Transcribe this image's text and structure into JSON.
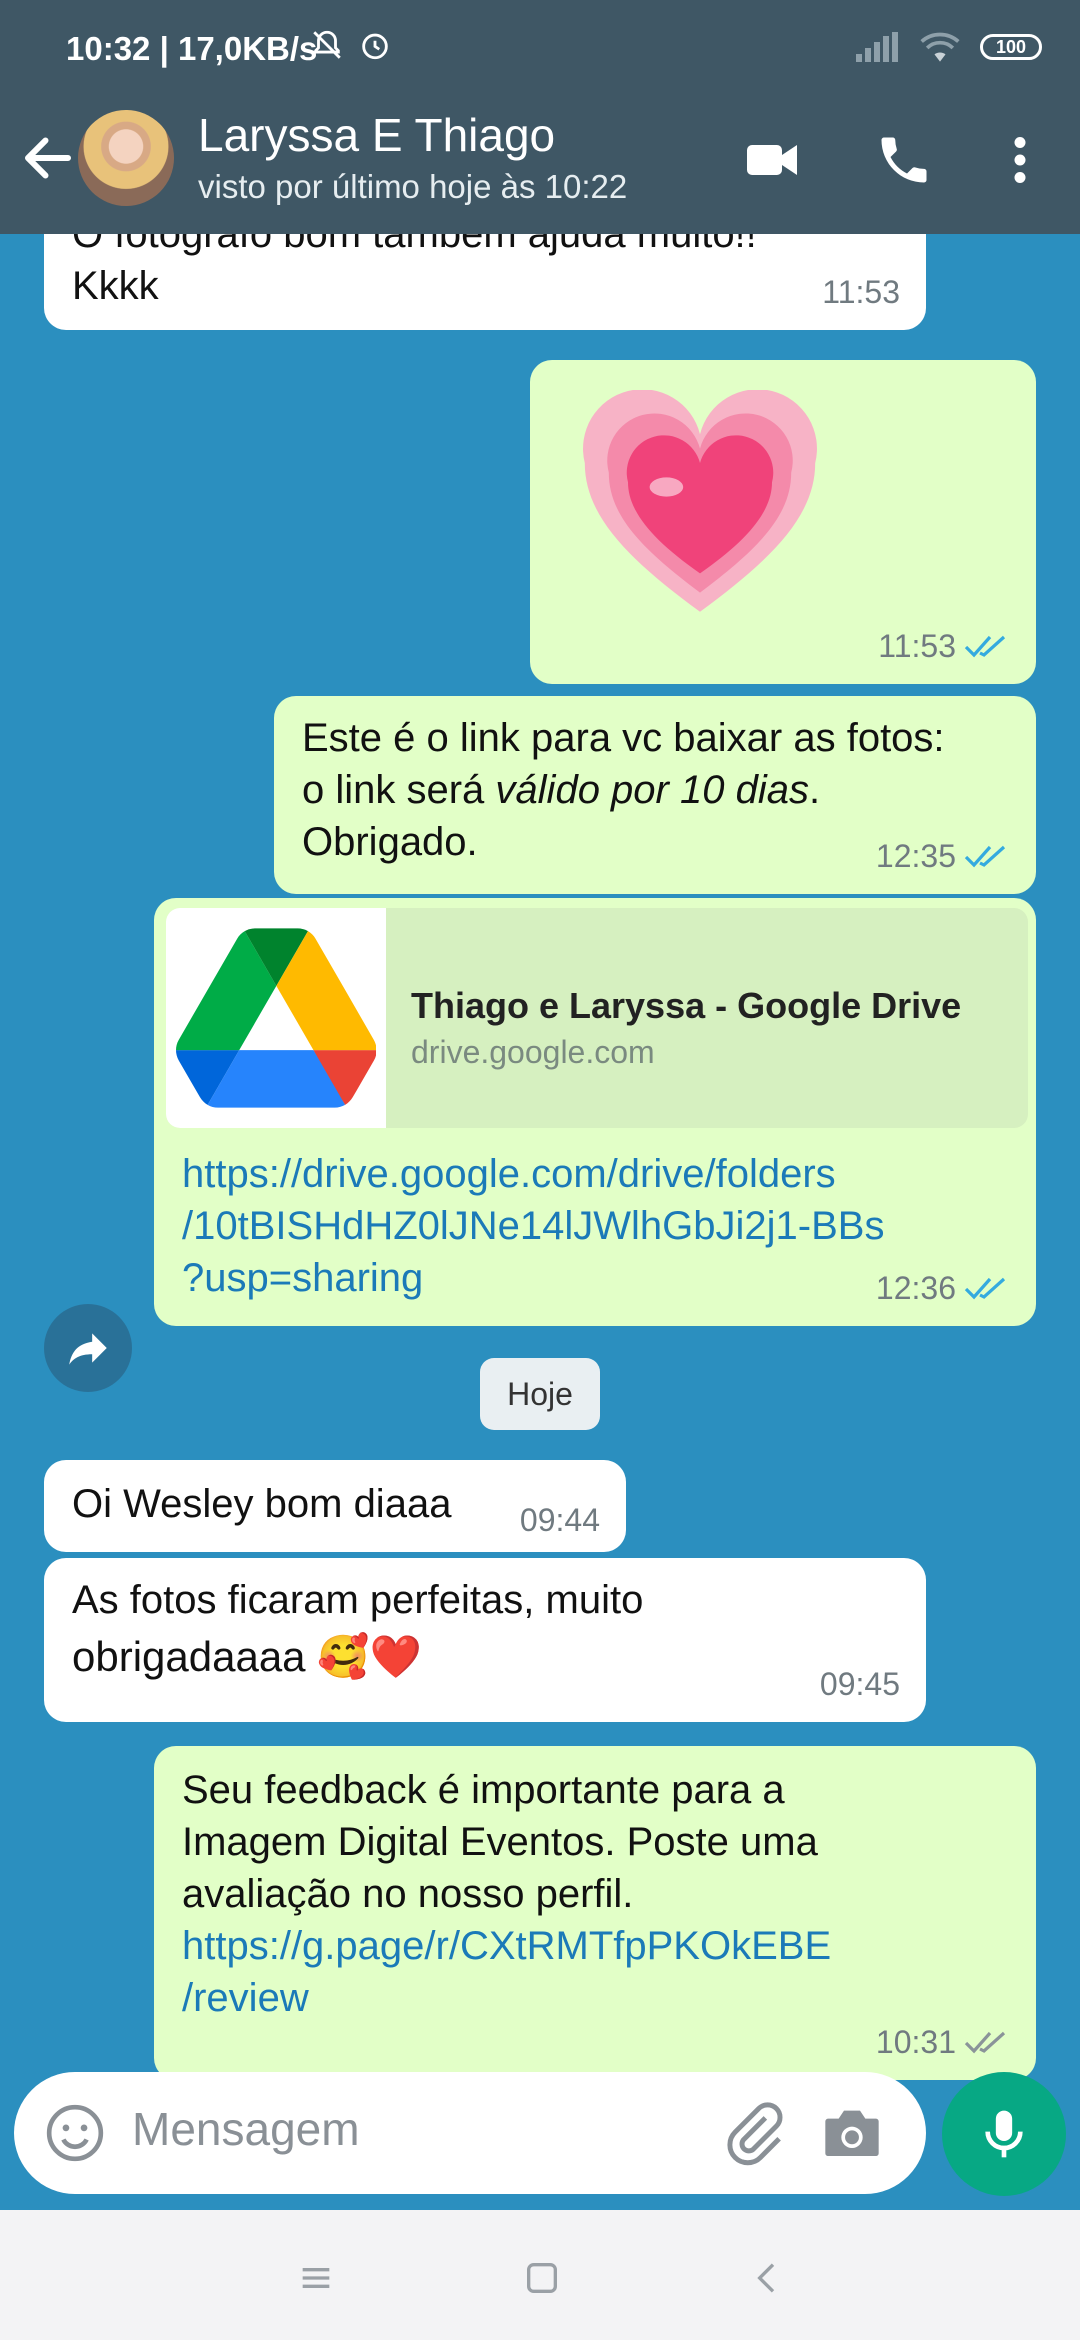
{
  "status_bar": {
    "time": "10:32 | 17,0KB/s",
    "battery": "100"
  },
  "header": {
    "contact_name": "Laryssa E Thiago",
    "last_seen": "visto por último hoje às 10:22"
  },
  "messages": [
    {
      "id": "m1",
      "direction": "in",
      "text": "O fotógrafo bom também ajuda muito!! Kkkk",
      "line1": "O fotógrafo bom também ajuda muito!!",
      "line2": "Kkkk",
      "time": "11:53"
    },
    {
      "id": "m2",
      "direction": "out",
      "type": "emoji",
      "emoji": "💗",
      "time": "11:53",
      "read": true
    },
    {
      "id": "m3",
      "direction": "out",
      "line1": "Este é o link para vc baixar as fotos:",
      "line2_pre": "o link será ",
      "line2_em": "válido por 10 dias",
      "line2_post": ".",
      "line3": "Obrigado.",
      "time": "12:35",
      "read": true
    },
    {
      "id": "m4",
      "direction": "out",
      "type": "link",
      "preview_title": "Thiago e Laryssa - Google Drive",
      "preview_domain": "drive.google.com",
      "url_line1": "https://drive.google.com/drive/folders",
      "url_line2": "/10tBISHdHZ0lJNe14lJWlhGbJi2j1-BBs",
      "url_line3": "?usp=sharing",
      "time": "12:36",
      "read": true
    },
    {
      "id": "m5",
      "direction": "in",
      "text": "Oi Wesley bom diaaa",
      "time": "09:44"
    },
    {
      "id": "m6",
      "direction": "in",
      "line1": "As fotos ficaram perfeitas, muito",
      "line2": "obrigadaaaa 🥰❤️",
      "time": "09:45"
    },
    {
      "id": "m7",
      "direction": "out",
      "line1": "Seu feedback é importante para a",
      "line2": "Imagem Digital Eventos. Poste uma",
      "line3": "avaliação no nosso perfil.",
      "url_line1": "https://g.page/r/CXtRMTfpPKOkEBE",
      "url_line2": "/review",
      "time": "10:31",
      "read": false
    }
  ],
  "date_divider": "Hoje",
  "composer": {
    "placeholder": "Mensagem"
  },
  "colors": {
    "header_bg": "#3f5765",
    "chat_bg": "#2b8fbf",
    "outgoing_bubble": "#e2ffc7",
    "incoming_bubble": "#ffffff",
    "link": "#1b7ab8",
    "mic_button": "#07a884",
    "read_ticks": "#34aadf"
  }
}
